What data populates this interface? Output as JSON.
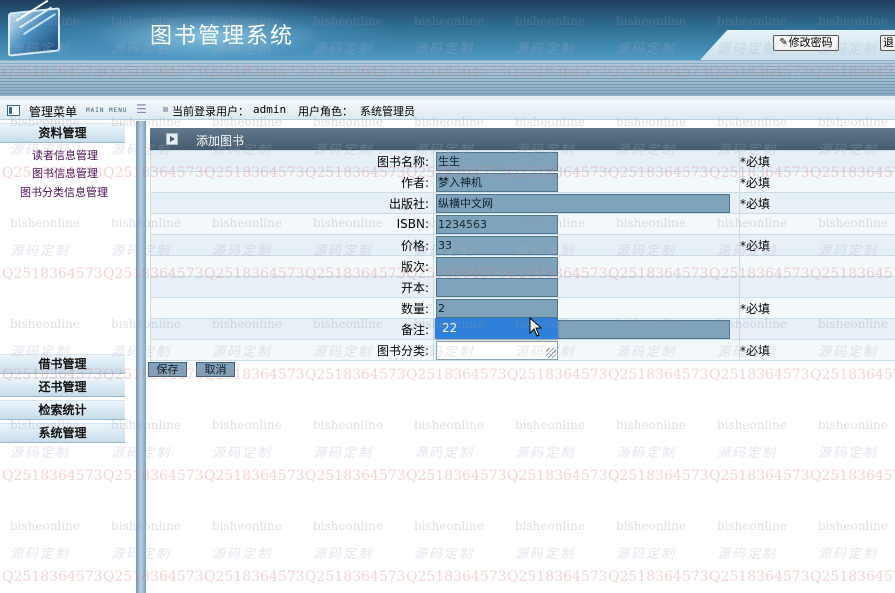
{
  "header": {
    "title": "图书管理系统",
    "change_password_label": "修改密码",
    "exit_label": "退",
    "pen_glyph": "✎"
  },
  "infobar": {
    "menu_title": "管理菜单",
    "menu_subtitle": "MAIN MENU",
    "login_label": "当前登录用户：",
    "login_user": "admin",
    "role_label": "用户角色：",
    "role_value": "系统管理员"
  },
  "sidebar": {
    "groups": [
      {
        "label": "资料管理",
        "items": [
          "读者信息管理",
          "图书信息管理",
          "图书分类信息管理"
        ]
      },
      {
        "label": "借书管理"
      },
      {
        "label": "还书管理"
      },
      {
        "label": "检索统计"
      },
      {
        "label": "系统管理"
      }
    ]
  },
  "panel": {
    "title": "添加图书"
  },
  "form": {
    "rows": [
      {
        "label": "图书名称:",
        "value": "生生",
        "required": "*必填"
      },
      {
        "label": "作者:",
        "value": "梦入神机",
        "required": "*必填"
      },
      {
        "label": "出版社:",
        "value": "纵横中文网",
        "required": "*必填"
      },
      {
        "label": "ISBN:",
        "value": "1234563",
        "required": ""
      },
      {
        "label": "价格:",
        "value": "33",
        "required": "*必填"
      },
      {
        "label": "版次:",
        "value": "",
        "required": ""
      },
      {
        "label": "开本:",
        "value": "",
        "required": ""
      },
      {
        "label": "数量:",
        "value": "2",
        "required": "*必填"
      },
      {
        "label": "备注:",
        "value": "",
        "required": ""
      },
      {
        "label": "图书分类:",
        "value": "",
        "required": "*必填"
      }
    ],
    "dropdown_option": "22",
    "save_label": "保存",
    "cancel_label": "取消"
  },
  "watermark": {
    "line1": "bisheonline",
    "line2": "源码定制",
    "line3": "Q2518364573"
  },
  "colors": {
    "header_blue": "#2f6f94",
    "field_fill": "#7ea3ba",
    "dropdown_highlight": "#2f80d8",
    "nav_link": "#4a0f52"
  }
}
